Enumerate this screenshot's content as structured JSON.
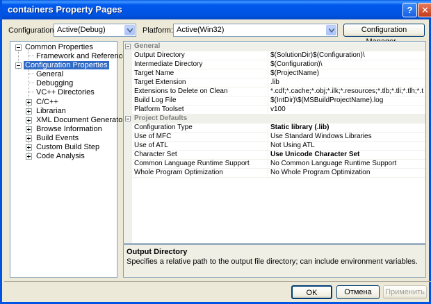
{
  "window": {
    "title": "containers Property Pages",
    "help_glyph": "?",
    "close_glyph": "✕"
  },
  "config": {
    "configuration_label": "Configuration:",
    "configuration_value": "Active(Debug)",
    "platform_label": "Platform:",
    "platform_value": "Active(Win32)",
    "manager_button": "Configuration Manager..."
  },
  "tree": [
    {
      "label": "Common Properties"
    },
    {
      "label": "Framework and References"
    },
    {
      "label": "Configuration Properties"
    },
    {
      "label": "General"
    },
    {
      "label": "Debugging"
    },
    {
      "label": "VC++ Directories"
    },
    {
      "label": "C/C++"
    },
    {
      "label": "Librarian"
    },
    {
      "label": "XML Document Generator"
    },
    {
      "label": "Browse Information"
    },
    {
      "label": "Build Events"
    },
    {
      "label": "Custom Build Step"
    },
    {
      "label": "Code Analysis"
    }
  ],
  "grid": {
    "categories": [
      {
        "name": "General",
        "rows": [
          {
            "name": "Output Directory",
            "value": "$(SolutionDir)$(Configuration)\\"
          },
          {
            "name": "Intermediate Directory",
            "value": "$(Configuration)\\"
          },
          {
            "name": "Target Name",
            "value": "$(ProjectName)"
          },
          {
            "name": "Target Extension",
            "value": ".lib"
          },
          {
            "name": "Extensions to Delete on Clean",
            "value": "*.cdf;*.cache;*.obj;*.ilk;*.resources;*.tlb;*.tli;*.tlh;*.t"
          },
          {
            "name": "Build Log File",
            "value": "$(IntDir)\\$(MSBuildProjectName).log"
          },
          {
            "name": "Platform Toolset",
            "value": "v100"
          }
        ]
      },
      {
        "name": "Project Defaults",
        "rows": [
          {
            "name": "Configuration Type",
            "value": "Static library (.lib)"
          },
          {
            "name": "Use of MFC",
            "value": "Use Standard Windows Libraries"
          },
          {
            "name": "Use of ATL",
            "value": "Not Using ATL"
          },
          {
            "name": "Character Set",
            "value": "Use Unicode Character Set"
          },
          {
            "name": "Common Language Runtime Support",
            "value": "No Common Language Runtime Support"
          },
          {
            "name": "Whole Program Optimization",
            "value": "No Whole Program Optimization"
          }
        ]
      }
    ]
  },
  "description": {
    "title": "Output Directory",
    "text": "Specifies a relative path to the output file directory; can include environment variables."
  },
  "buttons": {
    "ok": "OK",
    "cancel": "Отмена",
    "apply": "Применить"
  },
  "colors": {
    "titlebar": "#0054e3",
    "selection": "#316ac5",
    "face": "#ece9d8"
  }
}
